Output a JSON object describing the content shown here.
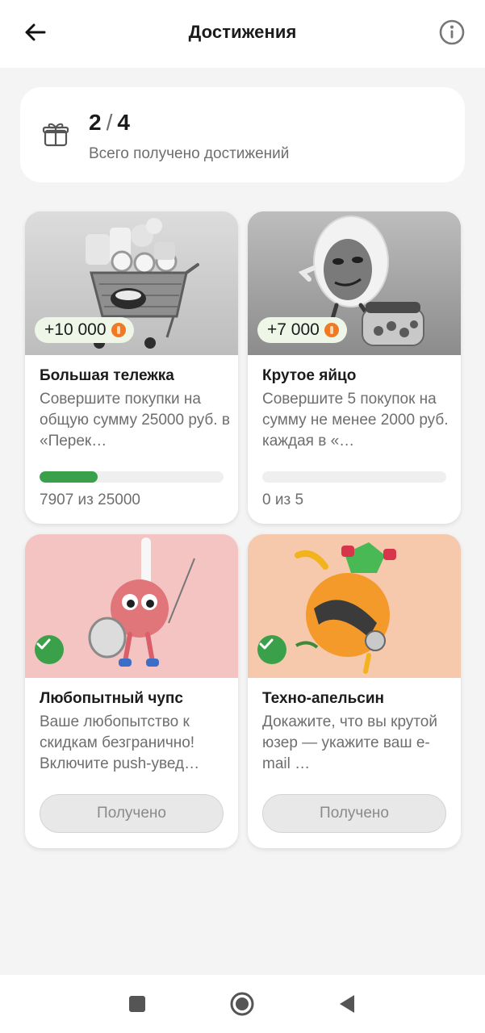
{
  "header": {
    "title": "Достижения",
    "back_icon": "arrow-left-icon",
    "info_icon": "info-icon"
  },
  "summary": {
    "earned": "2",
    "total": "4",
    "separator": "/",
    "label": "Всего получено достижений",
    "icon": "gift-icon"
  },
  "achievements": [
    {
      "title": "Большая тележка",
      "description": "Совершите покупки на общую сумму 25000 руб. в «Перек…",
      "reward": "+10 000",
      "progress_text": "7907 из 25000",
      "progress_current": 7907,
      "progress_target": 25000,
      "status": "in-progress"
    },
    {
      "title": "Крутое яйцо",
      "description": "Совершите 5 покупок на сумму не менее 2000 руб. каждая в «…",
      "reward": "+7 000",
      "progress_text": "0 из 5",
      "progress_current": 0,
      "progress_target": 5,
      "status": "in-progress"
    },
    {
      "title": "Любопытный чупс",
      "description": "Ваше любопытство к скидкам безгранично! Включите push-увед…",
      "button_label": "Получено",
      "status": "received"
    },
    {
      "title": "Техно-апельсин",
      "description": "Докажите, что вы крутой юзер — укажите ваш e-mail …",
      "button_label": "Получено",
      "status": "received"
    }
  ],
  "system_nav": {
    "recents_icon": "square-icon",
    "home_icon": "circle-icon",
    "back_icon": "triangle-back-icon"
  },
  "colors": {
    "accent_green": "#3aa14a",
    "coin_orange": "#f07a24",
    "background": "#f4f4f4"
  }
}
